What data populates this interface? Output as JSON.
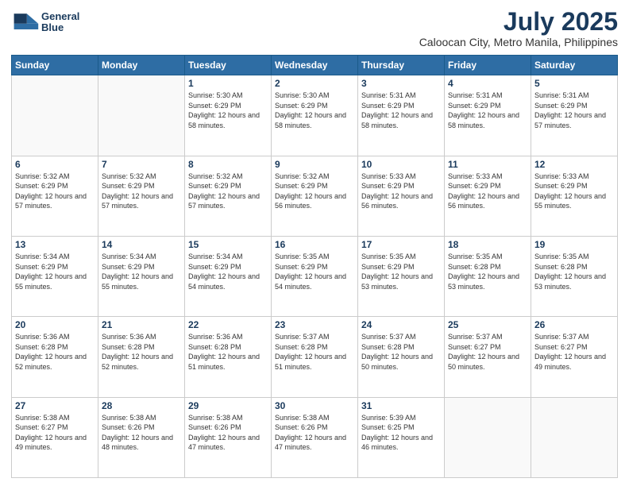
{
  "header": {
    "logo_line1": "General",
    "logo_line2": "Blue",
    "main_title": "July 2025",
    "subtitle": "Caloocan City, Metro Manila, Philippines"
  },
  "days_of_week": [
    "Sunday",
    "Monday",
    "Tuesday",
    "Wednesday",
    "Thursday",
    "Friday",
    "Saturday"
  ],
  "weeks": [
    [
      {
        "day": "",
        "sunrise": "",
        "sunset": "",
        "daylight": ""
      },
      {
        "day": "",
        "sunrise": "",
        "sunset": "",
        "daylight": ""
      },
      {
        "day": "1",
        "sunrise": "Sunrise: 5:30 AM",
        "sunset": "Sunset: 6:29 PM",
        "daylight": "Daylight: 12 hours and 58 minutes."
      },
      {
        "day": "2",
        "sunrise": "Sunrise: 5:30 AM",
        "sunset": "Sunset: 6:29 PM",
        "daylight": "Daylight: 12 hours and 58 minutes."
      },
      {
        "day": "3",
        "sunrise": "Sunrise: 5:31 AM",
        "sunset": "Sunset: 6:29 PM",
        "daylight": "Daylight: 12 hours and 58 minutes."
      },
      {
        "day": "4",
        "sunrise": "Sunrise: 5:31 AM",
        "sunset": "Sunset: 6:29 PM",
        "daylight": "Daylight: 12 hours and 58 minutes."
      },
      {
        "day": "5",
        "sunrise": "Sunrise: 5:31 AM",
        "sunset": "Sunset: 6:29 PM",
        "daylight": "Daylight: 12 hours and 57 minutes."
      }
    ],
    [
      {
        "day": "6",
        "sunrise": "Sunrise: 5:32 AM",
        "sunset": "Sunset: 6:29 PM",
        "daylight": "Daylight: 12 hours and 57 minutes."
      },
      {
        "day": "7",
        "sunrise": "Sunrise: 5:32 AM",
        "sunset": "Sunset: 6:29 PM",
        "daylight": "Daylight: 12 hours and 57 minutes."
      },
      {
        "day": "8",
        "sunrise": "Sunrise: 5:32 AM",
        "sunset": "Sunset: 6:29 PM",
        "daylight": "Daylight: 12 hours and 57 minutes."
      },
      {
        "day": "9",
        "sunrise": "Sunrise: 5:32 AM",
        "sunset": "Sunset: 6:29 PM",
        "daylight": "Daylight: 12 hours and 56 minutes."
      },
      {
        "day": "10",
        "sunrise": "Sunrise: 5:33 AM",
        "sunset": "Sunset: 6:29 PM",
        "daylight": "Daylight: 12 hours and 56 minutes."
      },
      {
        "day": "11",
        "sunrise": "Sunrise: 5:33 AM",
        "sunset": "Sunset: 6:29 PM",
        "daylight": "Daylight: 12 hours and 56 minutes."
      },
      {
        "day": "12",
        "sunrise": "Sunrise: 5:33 AM",
        "sunset": "Sunset: 6:29 PM",
        "daylight": "Daylight: 12 hours and 55 minutes."
      }
    ],
    [
      {
        "day": "13",
        "sunrise": "Sunrise: 5:34 AM",
        "sunset": "Sunset: 6:29 PM",
        "daylight": "Daylight: 12 hours and 55 minutes."
      },
      {
        "day": "14",
        "sunrise": "Sunrise: 5:34 AM",
        "sunset": "Sunset: 6:29 PM",
        "daylight": "Daylight: 12 hours and 55 minutes."
      },
      {
        "day": "15",
        "sunrise": "Sunrise: 5:34 AM",
        "sunset": "Sunset: 6:29 PM",
        "daylight": "Daylight: 12 hours and 54 minutes."
      },
      {
        "day": "16",
        "sunrise": "Sunrise: 5:35 AM",
        "sunset": "Sunset: 6:29 PM",
        "daylight": "Daylight: 12 hours and 54 minutes."
      },
      {
        "day": "17",
        "sunrise": "Sunrise: 5:35 AM",
        "sunset": "Sunset: 6:29 PM",
        "daylight": "Daylight: 12 hours and 53 minutes."
      },
      {
        "day": "18",
        "sunrise": "Sunrise: 5:35 AM",
        "sunset": "Sunset: 6:28 PM",
        "daylight": "Daylight: 12 hours and 53 minutes."
      },
      {
        "day": "19",
        "sunrise": "Sunrise: 5:35 AM",
        "sunset": "Sunset: 6:28 PM",
        "daylight": "Daylight: 12 hours and 53 minutes."
      }
    ],
    [
      {
        "day": "20",
        "sunrise": "Sunrise: 5:36 AM",
        "sunset": "Sunset: 6:28 PM",
        "daylight": "Daylight: 12 hours and 52 minutes."
      },
      {
        "day": "21",
        "sunrise": "Sunrise: 5:36 AM",
        "sunset": "Sunset: 6:28 PM",
        "daylight": "Daylight: 12 hours and 52 minutes."
      },
      {
        "day": "22",
        "sunrise": "Sunrise: 5:36 AM",
        "sunset": "Sunset: 6:28 PM",
        "daylight": "Daylight: 12 hours and 51 minutes."
      },
      {
        "day": "23",
        "sunrise": "Sunrise: 5:37 AM",
        "sunset": "Sunset: 6:28 PM",
        "daylight": "Daylight: 12 hours and 51 minutes."
      },
      {
        "day": "24",
        "sunrise": "Sunrise: 5:37 AM",
        "sunset": "Sunset: 6:28 PM",
        "daylight": "Daylight: 12 hours and 50 minutes."
      },
      {
        "day": "25",
        "sunrise": "Sunrise: 5:37 AM",
        "sunset": "Sunset: 6:27 PM",
        "daylight": "Daylight: 12 hours and 50 minutes."
      },
      {
        "day": "26",
        "sunrise": "Sunrise: 5:37 AM",
        "sunset": "Sunset: 6:27 PM",
        "daylight": "Daylight: 12 hours and 49 minutes."
      }
    ],
    [
      {
        "day": "27",
        "sunrise": "Sunrise: 5:38 AM",
        "sunset": "Sunset: 6:27 PM",
        "daylight": "Daylight: 12 hours and 49 minutes."
      },
      {
        "day": "28",
        "sunrise": "Sunrise: 5:38 AM",
        "sunset": "Sunset: 6:26 PM",
        "daylight": "Daylight: 12 hours and 48 minutes."
      },
      {
        "day": "29",
        "sunrise": "Sunrise: 5:38 AM",
        "sunset": "Sunset: 6:26 PM",
        "daylight": "Daylight: 12 hours and 47 minutes."
      },
      {
        "day": "30",
        "sunrise": "Sunrise: 5:38 AM",
        "sunset": "Sunset: 6:26 PM",
        "daylight": "Daylight: 12 hours and 47 minutes."
      },
      {
        "day": "31",
        "sunrise": "Sunrise: 5:39 AM",
        "sunset": "Sunset: 6:25 PM",
        "daylight": "Daylight: 12 hours and 46 minutes."
      },
      {
        "day": "",
        "sunrise": "",
        "sunset": "",
        "daylight": ""
      },
      {
        "day": "",
        "sunrise": "",
        "sunset": "",
        "daylight": ""
      }
    ]
  ]
}
